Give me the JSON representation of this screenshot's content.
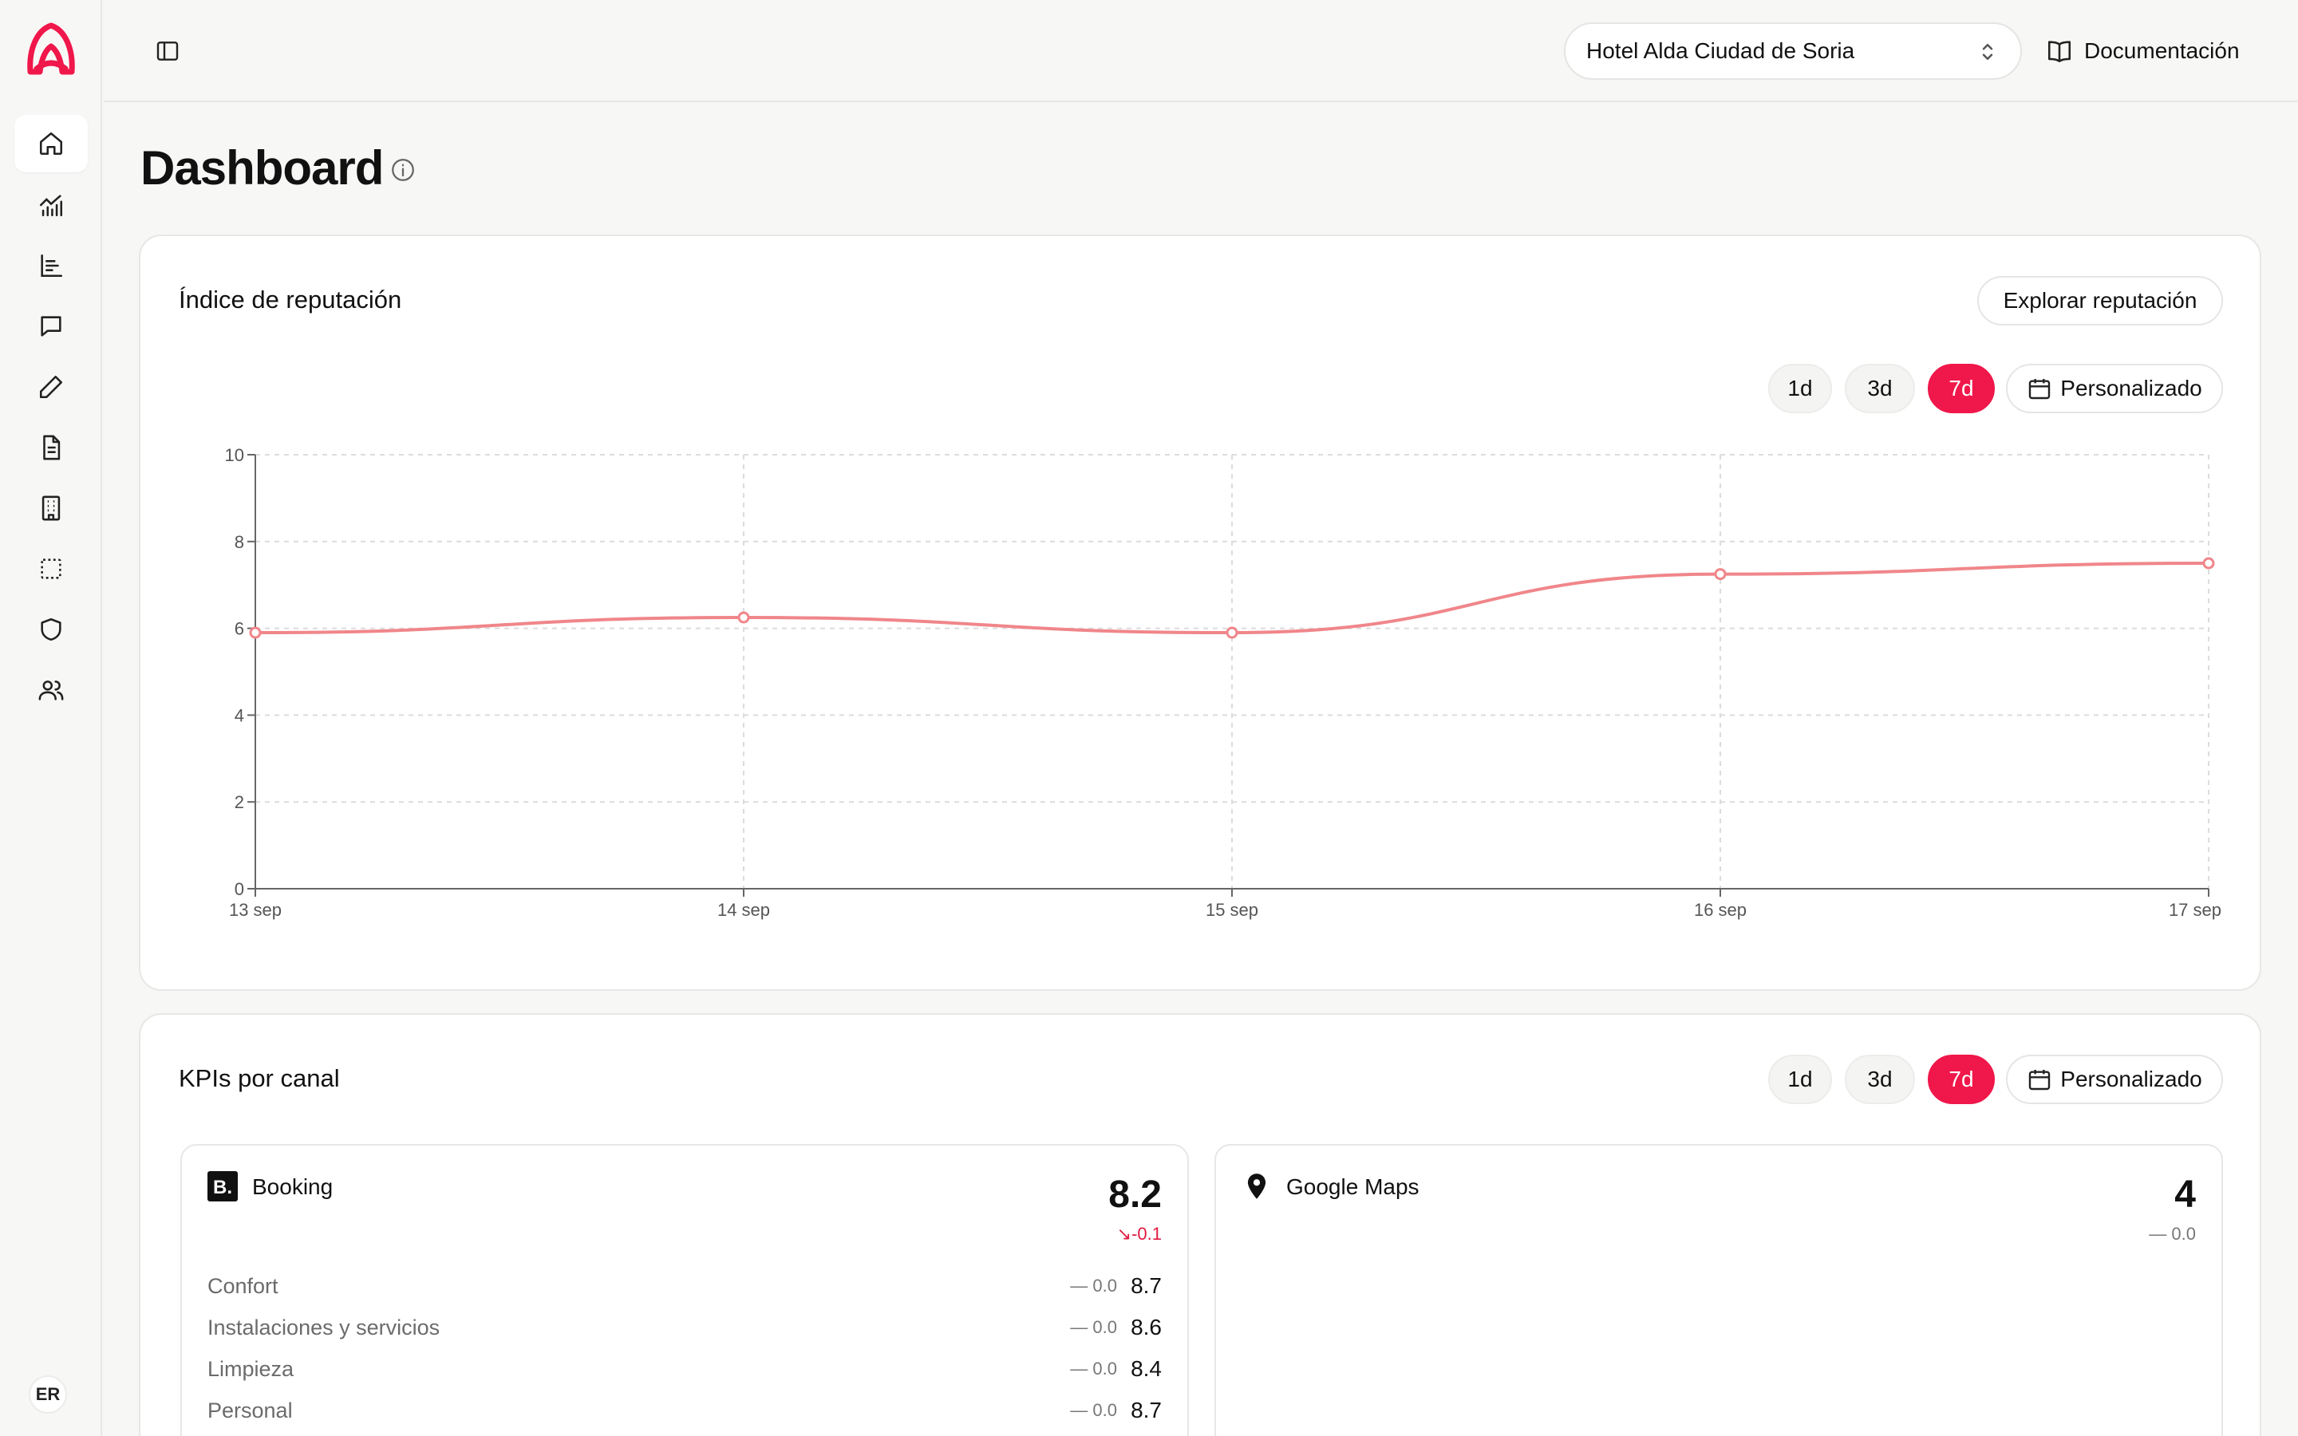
{
  "sidebar": {
    "items": [
      {
        "icon": "home-icon",
        "active": true
      },
      {
        "icon": "analytics-icon"
      },
      {
        "icon": "bar-chart-icon"
      },
      {
        "icon": "message-icon"
      },
      {
        "icon": "pencil-icon"
      },
      {
        "icon": "document-icon"
      },
      {
        "icon": "building-icon"
      },
      {
        "icon": "dashed-square-icon"
      },
      {
        "icon": "shield-icon"
      },
      {
        "icon": "users-icon"
      }
    ],
    "user_initials": "ER"
  },
  "header": {
    "hotel": "Hotel Alda Ciudad de Soria",
    "docs_label": "Documentación"
  },
  "page": {
    "title": "Dashboard"
  },
  "reputation": {
    "title": "Índice de reputación",
    "explore_label": "Explorar reputación",
    "ranges": [
      "1d",
      "3d",
      "7d"
    ],
    "active_range": "7d",
    "custom_label": "Personalizado"
  },
  "chart_data": {
    "type": "line",
    "x": [
      "13 sep",
      "14 sep",
      "15 sep",
      "16 sep",
      "17 sep"
    ],
    "series": [
      {
        "values": [
          5.9,
          6.25,
          5.9,
          7.25,
          7.5
        ],
        "color": "#f0868a"
      }
    ],
    "ylim": [
      0,
      10
    ],
    "yticks": [
      "0",
      "2",
      "4",
      "6",
      "8",
      "10"
    ],
    "grid": true
  },
  "kpis": {
    "title": "KPIs por canal",
    "ranges": [
      "1d",
      "3d",
      "7d"
    ],
    "active_range": "7d",
    "custom_label": "Personalizado",
    "channels": [
      {
        "name": "Booking",
        "logo": "booking-logo-icon",
        "score": "8.2",
        "delta": "-0.1",
        "rows": [
          {
            "label": "Confort",
            "delta": "— 0.0",
            "value": "8.7"
          },
          {
            "label": "Instalaciones y servicios",
            "delta": "— 0.0",
            "value": "8.6"
          },
          {
            "label": "Limpieza",
            "delta": "— 0.0",
            "value": "8.4"
          },
          {
            "label": "Personal",
            "delta": "— 0.0",
            "value": "8.7"
          }
        ]
      },
      {
        "name": "Google Maps",
        "logo": "map-pin-icon",
        "score": "4",
        "delta": "— 0.0",
        "rows": []
      }
    ]
  },
  "colors": {
    "accent": "#f0174a",
    "line": "#f0868a"
  }
}
